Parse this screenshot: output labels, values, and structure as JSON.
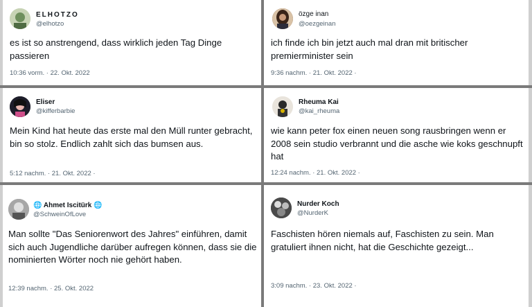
{
  "tweets": [
    {
      "name": "ELHOTZO",
      "handle": "@elhotzo",
      "text": "es ist so anstrengend, dass wirklich jeden Tag Dinge passieren",
      "meta": "10:36 vorm. · 22. Okt. 2022"
    },
    {
      "name": "özge inan",
      "handle": "@oezgeinan",
      "text": "ich finde ich bin jetzt auch mal dran mit britischer premierminister sein",
      "meta": "9:36 nachm. · 21. Okt. 2022 ·"
    },
    {
      "name": "Eliser",
      "handle": "@kifferbarbie",
      "text": "Mein Kind hat heute das erste mal den Müll runter gebracht, bin so stolz. Endlich zahlt sich das bumsen aus.",
      "meta": "5:12 nachm. · 21. Okt. 2022 ·"
    },
    {
      "name": "Rheuma Kai",
      "handle": "@kai_rheuma",
      "text": "wie kann peter fox einen neuen song rausbringen wenn er 2008 sein studio verbrannt und die asche wie koks geschnupft hat",
      "meta": "12:24 nachm. · 21. Okt. 2022 ·"
    },
    {
      "name": "Ahmet Iscitürk",
      "handle": "@SchweinOfLove",
      "text": "Man sollte \"Das Seniorenwort des Jahres\" einführen, damit sich auch Jugendliche darüber aufregen können, dass sie die nominierten Wörter noch nie gehört haben.",
      "meta": "12:39 nachm. · 25. Okt. 2022"
    },
    {
      "name": "Nurder Koch",
      "handle": "@NurderK",
      "text": "Faschisten hören niemals auf, Faschisten zu sein. Man gratuliert ihnen nicht, hat die Geschichte gezeigt...",
      "meta": "3:09 nachm. · 23. Okt. 2022 ·"
    }
  ]
}
